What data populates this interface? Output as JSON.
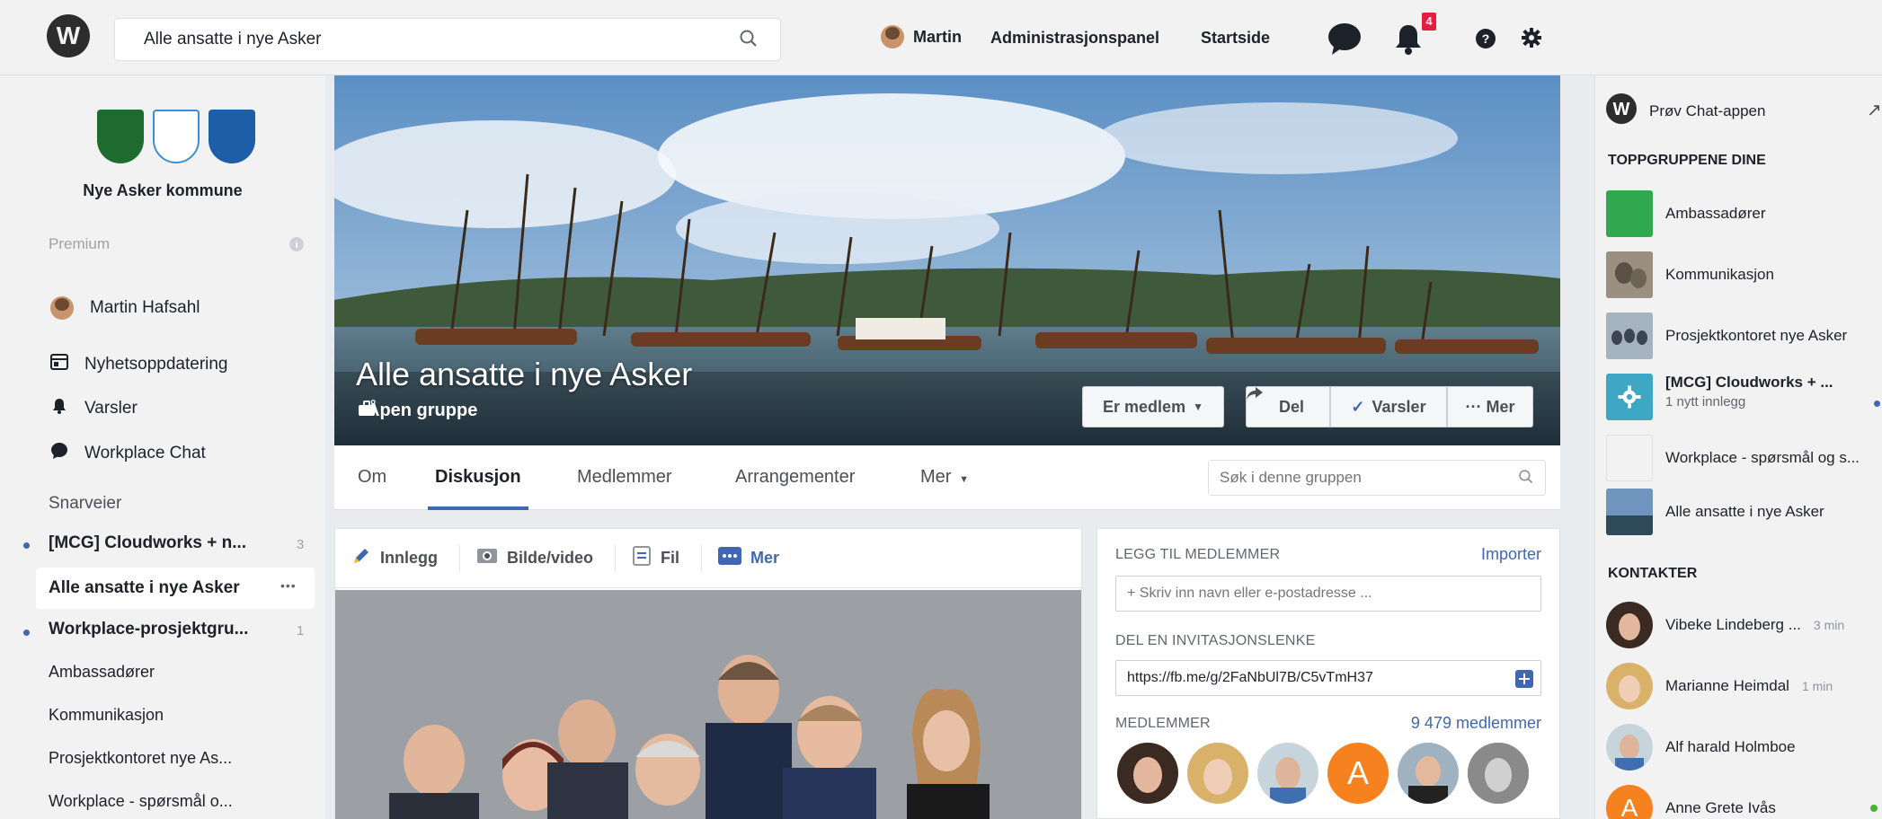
{
  "topbar": {
    "search_value": "Alle ansatte i nye Asker",
    "user_name": "Martin",
    "admin_label": "Administrasjonspanel",
    "home_label": "Startside",
    "notification_count": "4"
  },
  "left": {
    "org_name": "Nye Asker kommune",
    "premium_label": "Premium",
    "profile_name": "Martin Hafsahl",
    "nav": [
      {
        "label": "Nyhetsoppdatering",
        "icon": "newsfeed-icon"
      },
      {
        "label": "Varsler",
        "icon": "bell-icon"
      },
      {
        "label": "Workplace Chat",
        "icon": "chat-icon"
      }
    ],
    "shortcuts_label": "Snarveier",
    "groups": [
      {
        "label": "[MCG] Cloudworks + n...",
        "count": "3",
        "unread": true
      },
      {
        "label": "Alle ansatte i nye Asker",
        "more": "•••",
        "selected": true
      },
      {
        "label": "Workplace-prosjektgru...",
        "count": "1",
        "unread": true
      },
      {
        "label": "Ambassadører"
      },
      {
        "label": "Kommunikasjon"
      },
      {
        "label": "Prosjektkontoret nye As..."
      },
      {
        "label": "Workplace - spørsmål o..."
      }
    ]
  },
  "cover": {
    "title": "Alle ansatte i nye Asker",
    "subtitle": "Åpen gruppe",
    "member_button": "Er medlem",
    "share_button": "Del",
    "notify_button": "Varsler",
    "more_button": "··· Mer"
  },
  "tabs": {
    "items": [
      "Om",
      "Diskusjon",
      "Medlemmer",
      "Arrangementer",
      "Mer"
    ],
    "search_placeholder": "Søk i denne gruppen"
  },
  "composer": {
    "post": "Innlegg",
    "photo": "Bilde/video",
    "file": "Fil",
    "more": "Mer"
  },
  "add_members": {
    "heading": "LEGG TIL MEDLEMMER",
    "import_label": "Importer",
    "input_placeholder": "+ Skriv inn navn eller e-postadresse ...",
    "invite_heading": "DEL EN INVITASJONSLENKE",
    "invite_link": "https://fb.me/g/2FaNbUl7B/C5vTmH37",
    "members_heading": "MEDLEMMER",
    "member_count": "9 479 medlemmer",
    "avatar_letter": "A"
  },
  "right": {
    "chat_app": "Prøv Chat-appen",
    "top_groups_heading": "TOPPGRUPPENE DINE",
    "groups": [
      {
        "name": "Ambassadører"
      },
      {
        "name": "Kommunikasjon"
      },
      {
        "name": "Prosjektkontoret nye Asker"
      },
      {
        "name": "[MCG] Cloudworks + ...",
        "sub": "1 nytt innlegg"
      },
      {
        "name": "Workplace - spørsmål og s..."
      },
      {
        "name": "Alle ansatte i nye Asker"
      }
    ],
    "contacts_heading": "KONTAKTER",
    "contacts": [
      {
        "name": "Vibeke Lindeberg ...",
        "time": "3 min"
      },
      {
        "name": "Marianne Heimdal",
        "time": "1 min"
      },
      {
        "name": "Alf harald Holmboe"
      },
      {
        "name": "Anne Grete Ivås",
        "initial": "A"
      }
    ]
  },
  "colors": {
    "accent": "#4267b2",
    "badge": "#e41e3f",
    "online": "#42b72a",
    "avatar_orange": "#f5821f"
  }
}
